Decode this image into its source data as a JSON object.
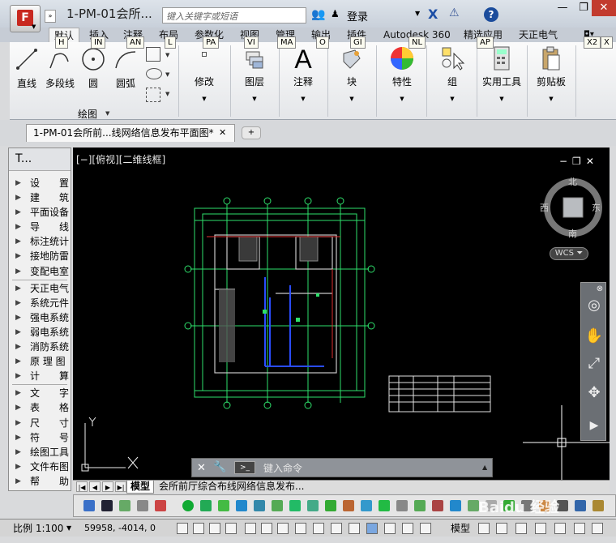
{
  "title_bar": {
    "app_button_letter": "F",
    "document_title": "1-PM-01会所...",
    "search_placeholder": "键入关键字或短语",
    "login_label": "登录",
    "help_label": "?",
    "minimize": "—",
    "restore": "❐",
    "close": "✕"
  },
  "ribbon_tabs": [
    {
      "label": "默认",
      "keytip": "H"
    },
    {
      "label": "插入",
      "keytip": "IN"
    },
    {
      "label": "注释",
      "keytip": "AN"
    },
    {
      "label": "布局",
      "keytip": "L"
    },
    {
      "label": "参数化",
      "keytip": "PA"
    },
    {
      "label": "视图",
      "keytip": "VI"
    },
    {
      "label": "管理",
      "keytip": "MA"
    },
    {
      "label": "输出",
      "keytip": "O"
    },
    {
      "label": "插件",
      "keytip": "GI"
    },
    {
      "label": "Autodesk 360",
      "keytip": "NL"
    },
    {
      "label": "精选应用",
      "keytip": "AP"
    },
    {
      "label": "天正电气",
      "keytip": ""
    }
  ],
  "ribbon_extra_keytips": [
    "X2",
    "X"
  ],
  "ribbon": {
    "draw_panel_label": "绘图",
    "buttons": {
      "line": "直线",
      "polyline": "多段线",
      "circle": "圆",
      "arc": "圆弧",
      "modify": "修改",
      "layers": "图层",
      "annotation": "注释",
      "block": "块",
      "properties": "特性",
      "groups": "组",
      "utilities": "实用工具",
      "clipboard": "剪贴板"
    }
  },
  "document_tab": {
    "label": "1-PM-01会所前...线网络信息发布平面图*",
    "close": "✕"
  },
  "tool_palette": {
    "title": "T...",
    "items": [
      "设　　置",
      "建　　筑",
      "平面设备",
      "导　　线",
      "标注统计",
      "接地防雷",
      "变配电室",
      "天正电气",
      "系统元件",
      "强电系统",
      "弱电系统",
      "消防系统",
      "原 理 图",
      "计　　算",
      "文　　字",
      "表　　格",
      "尺　　寸",
      "符　　号",
      "绘图工具",
      "文件布图",
      "帮　　助"
    ]
  },
  "viewport": {
    "label": "[−][俯视][二维线框]",
    "controls": "−❐✕"
  },
  "viewcube": {
    "north": "北",
    "south": "南",
    "east": "东",
    "west": "西",
    "wcs": "WCS ⏷"
  },
  "command_line": {
    "close": "✕",
    "placeholder": "键入命令"
  },
  "layout_tabs": {
    "model": "模型",
    "layout": "会所前厅综合布线网络信息发布..."
  },
  "status_bar": {
    "scale": "比例 1:100",
    "coordinates": "59958, -4014, 0",
    "model": "模型"
  },
  "watermark": "Baidu 经验",
  "colors": {
    "canvas_bg": "#000000",
    "drawing_green": "#2ee06b",
    "drawing_blue": "#2a4cff",
    "drawing_red": "#e03030",
    "title_bar": "#d2d9e2",
    "close_button": "#c23b2e"
  }
}
